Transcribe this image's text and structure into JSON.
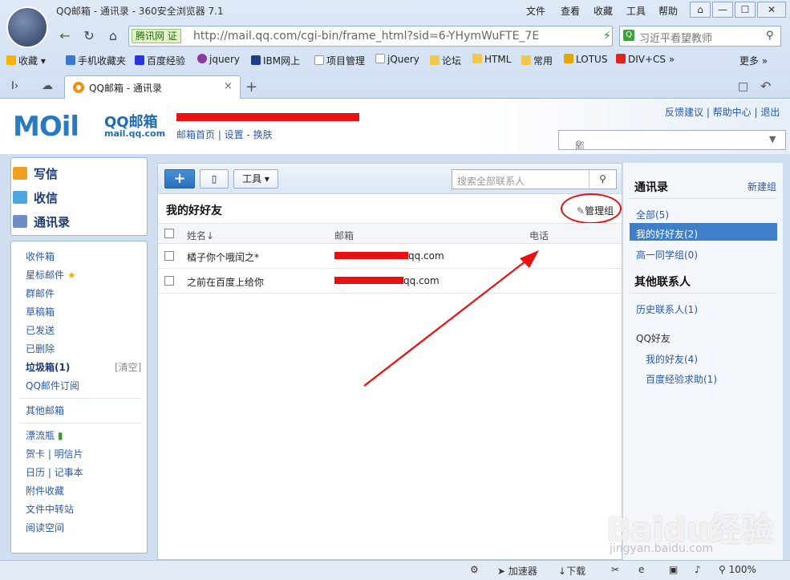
{
  "browser": {
    "title": "QQ邮箱 - 通讯录 - 360安全浏览器 7.1",
    "menu": [
      "文件",
      "查看",
      "收藏",
      "工具",
      "帮助"
    ],
    "window_buttons": [
      "⌂",
      "—",
      "☐",
      "✕"
    ],
    "brand_chip": "腾讯网 证",
    "url": "http://mail.qq.com/cgi-bin/frame_html?sid=6-YHymWuFTE_7E",
    "search_value": "习近平看望教师",
    "bookmarks": [
      "收藏",
      "手机收藏夹",
      "百度经验",
      "jquery",
      "IBM网上",
      "项目管理",
      "jQuery",
      "论坛",
      "HTML",
      "常用",
      "LOTUS",
      "DIV+CS"
    ],
    "bookmarks_more": "更多",
    "tab_label": "QQ邮箱 - 通讯录",
    "tab_close": "×",
    "new_tab": "+"
  },
  "mail": {
    "logo_text": "MOil",
    "logo_cn": "QQ邮箱",
    "logo_url": "mail.qq.com",
    "header_links": "邮箱首页 | 设置 - 换肤",
    "top_links": "反馈建议 | 帮助中心 | 退出",
    "search_placeholder": "邮件搜索...",
    "actions": {
      "compose": "写信",
      "inbox": "收信",
      "contacts": "通讯录"
    },
    "folders": [
      "收件箱",
      "星标邮件",
      "群邮件",
      "草稿箱",
      "已发送",
      "已删除",
      "垃圾箱(1)",
      "QQ邮件订阅"
    ],
    "spam_clear": "[清空]",
    "other_mail": "其他邮箱",
    "extras": [
      "漂流瓶",
      "贺卡 | 明信片",
      "日历 | 记事本",
      "附件收藏",
      "文件中转站",
      "阅读空间"
    ]
  },
  "contacts": {
    "toolbar": {
      "add": "+",
      "phone": "▯",
      "tools": "工具 ▾"
    },
    "search_placeholder": "搜索全部联系人",
    "group_title": "我的好好友",
    "manage_group": "管理组",
    "columns": {
      "name": "姓名↓",
      "email": "邮箱",
      "phone": "电话"
    },
    "rows": [
      {
        "name": "橘子你个哦闰之*",
        "email_suffix": "qq.com"
      },
      {
        "name": "之前在百度上给你",
        "email_suffix": "qq.com"
      }
    ]
  },
  "groups": {
    "title": "通讯录",
    "new_group": "新建组",
    "items": [
      "全部(5)",
      "我的好好友(2)",
      "高一同学组(0)"
    ],
    "other_title": "其他联系人",
    "history": "历史联系人(1)",
    "qq_friends": "QQ好友",
    "qq_sub": [
      "我的好友(4)",
      "百度经验求助(1)"
    ]
  },
  "statusbar": {
    "accelerator": "加速器",
    "download": "下载",
    "zoom": "100%"
  },
  "watermark": {
    "main": "Baidu经验",
    "sub": "jingyan.baidu.com"
  }
}
